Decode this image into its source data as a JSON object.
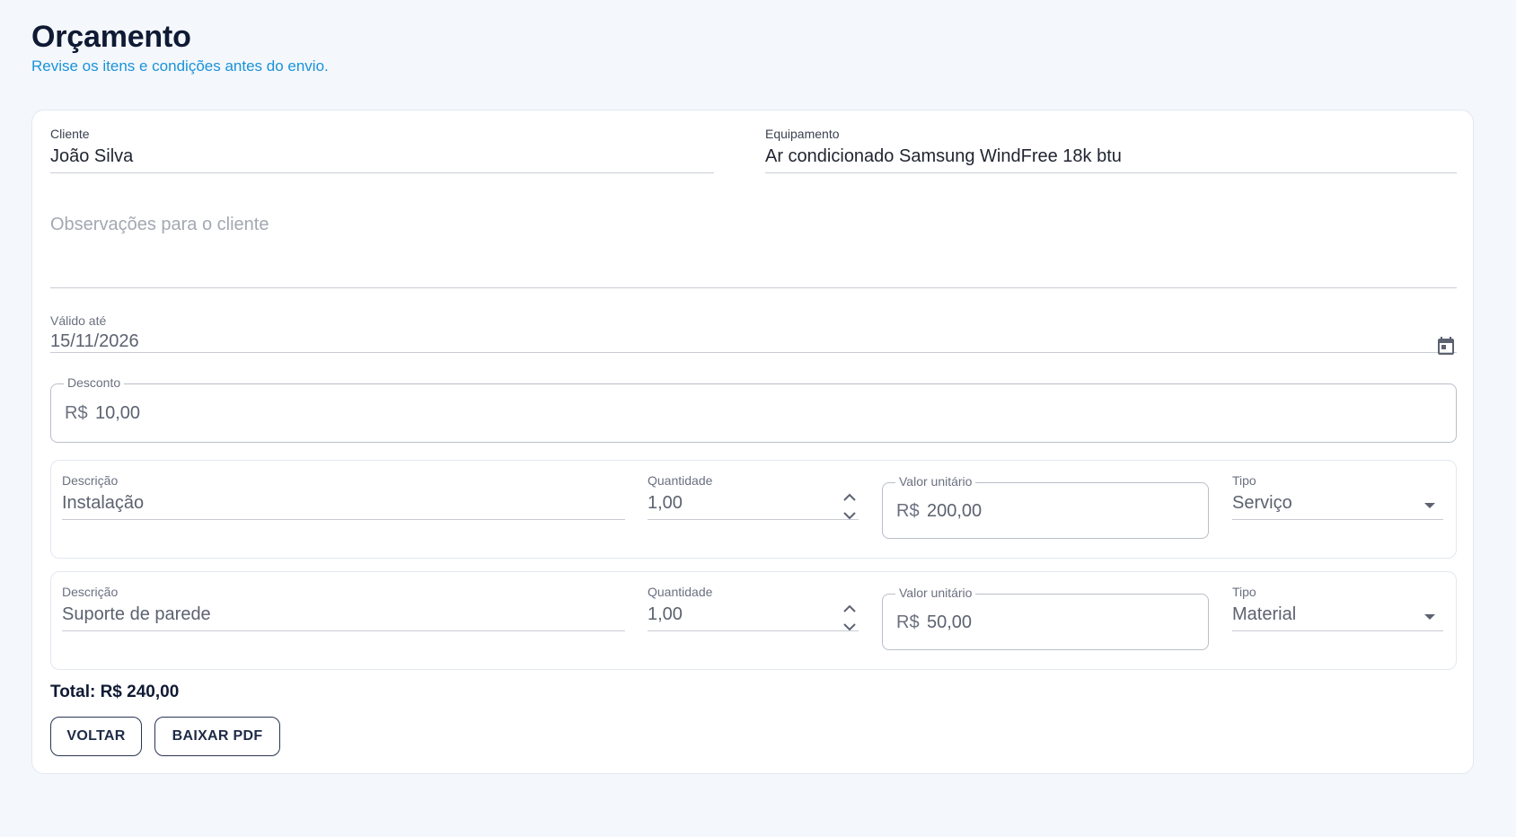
{
  "header": {
    "title": "Orçamento",
    "subtitle": "Revise os itens e condições antes do envio."
  },
  "form": {
    "client_label": "Cliente",
    "client_value": "João Silva",
    "equipment_label": "Equipamento",
    "equipment_value": "Ar condicionado Samsung WindFree 18k btu",
    "notes_placeholder": "Observações para o cliente",
    "valid_until_label": "Válido até",
    "valid_until_value": "15/11/2026",
    "discount_label": "Desconto",
    "discount_prefix": "R$",
    "discount_value": "10,00"
  },
  "items": [
    {
      "description_label": "Descrição",
      "description_value": "Instalação",
      "quantity_label": "Quantidade",
      "quantity_value": "1,00",
      "unit_value_label": "Valor unitário",
      "unit_value_prefix": "R$",
      "unit_value": "200,00",
      "type_label": "Tipo",
      "type_value": "Serviço"
    },
    {
      "description_label": "Descrição",
      "description_value": "Suporte de parede",
      "quantity_label": "Quantidade",
      "quantity_value": "1,00",
      "unit_value_label": "Valor unitário",
      "unit_value_prefix": "R$",
      "unit_value": "50,00",
      "type_label": "Tipo",
      "type_value": "Material"
    }
  ],
  "summary": {
    "total": "Total: R$ 240,00"
  },
  "actions": {
    "back_label": "VOLTAR",
    "download_label": "BAIXAR PDF"
  },
  "icons": {
    "calendar": "calendar-icon",
    "stepper": "stepper-icon",
    "dropdown": "chevron-down-icon"
  },
  "colors": {
    "background": "#f4f7fc",
    "subtitle": "#1a93d8",
    "title": "#0f1a33",
    "button_border": "#2a3553"
  }
}
